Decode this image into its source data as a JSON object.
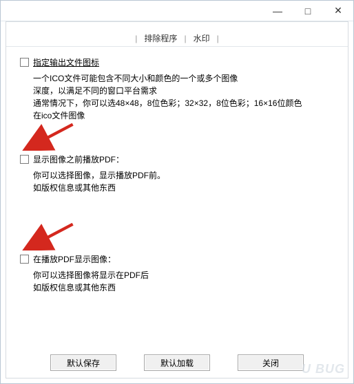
{
  "titlebar": {
    "minimize": "—",
    "maximize": "□",
    "close": "✕"
  },
  "tabs": {
    "sep": "|",
    "tab_sort": "排除程序",
    "tab_wm": "水印"
  },
  "group_icon": {
    "checkbox_label": "指定输出文件图标",
    "desc1": "一个ICO文件可能包含不同大小和颜色的一个或多个图像",
    "desc2": "深度，以满足不同的窗口平台需求",
    "desc3": "通常情况下，你可以选48×48，8位色彩；32×32，8位色彩；16×16位颜色",
    "desc4": "在ico文件图像"
  },
  "group_before": {
    "checkbox_label": "显示图像之前播放PDF：",
    "desc1": "你可以选择图像，显示播放PDF前。",
    "desc2": "如版权信息或其他东西"
  },
  "group_after": {
    "checkbox_label": "在播放PDF显示图像：",
    "desc1": "你可以选择图像将显示在PDF后",
    "desc2": "如版权信息或其他东西"
  },
  "buttons": {
    "save": "默认保存",
    "load": "默认加载",
    "close": "关闭"
  },
  "watermark": "U BUG"
}
